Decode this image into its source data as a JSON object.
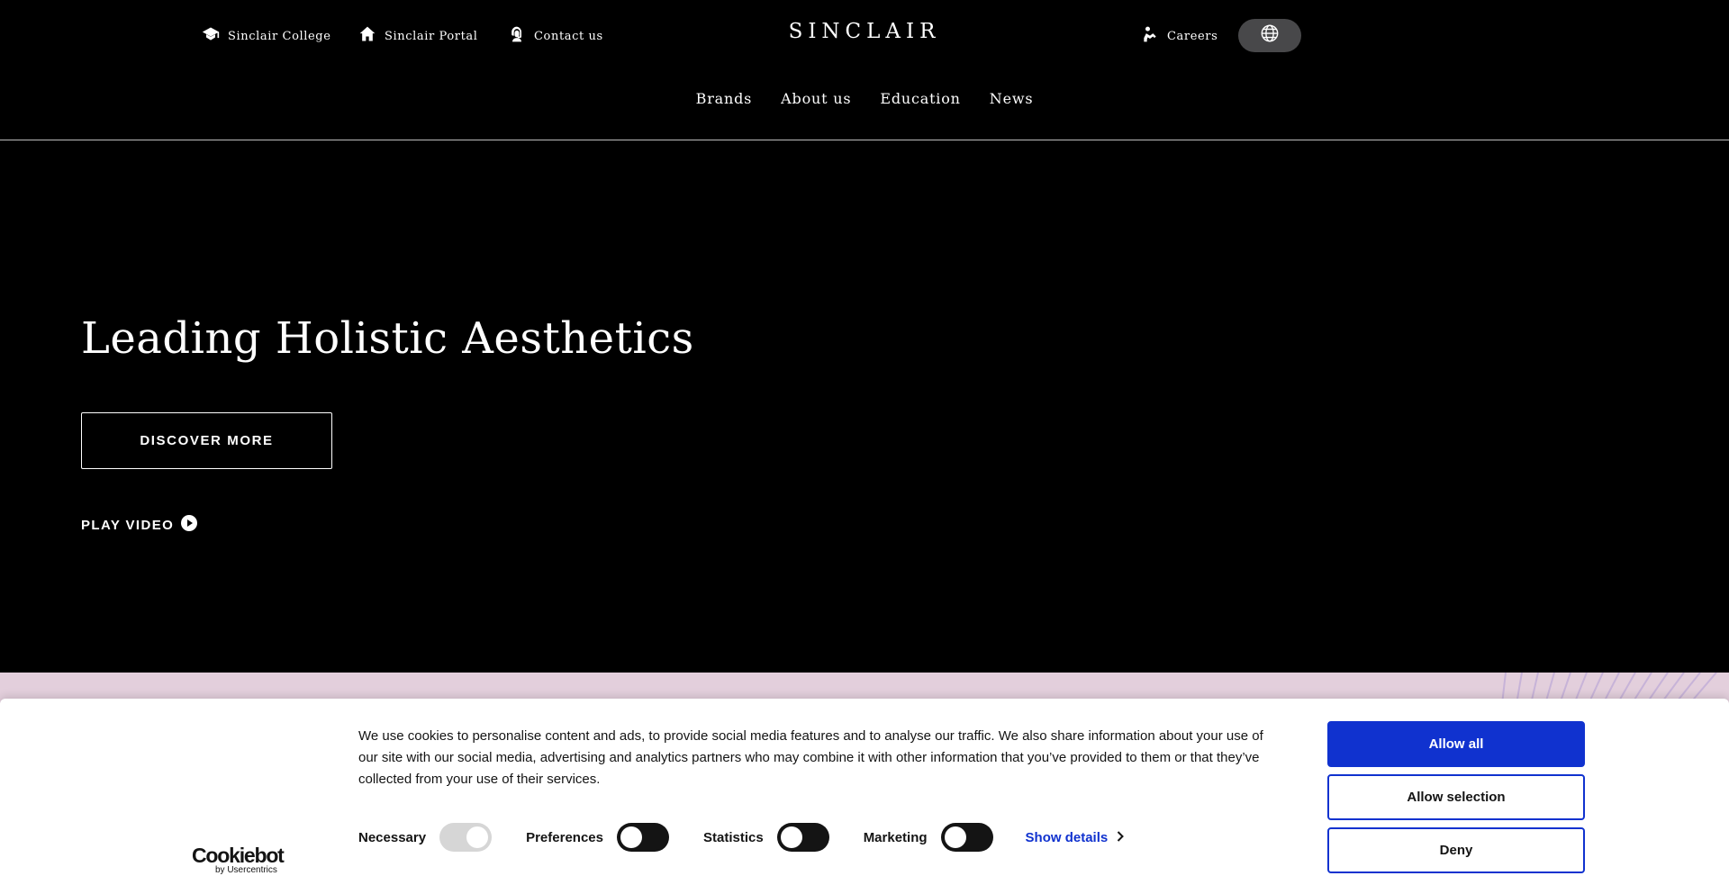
{
  "header": {
    "utility_left": [
      {
        "label": "Sinclair College",
        "icon": "graduation-cap-icon"
      },
      {
        "label": "Sinclair Portal",
        "icon": "home-icon"
      },
      {
        "label": "Contact us",
        "icon": "support-agent-icon"
      }
    ],
    "logo": "SINCLAIR",
    "careers": {
      "label": "Careers",
      "icon": "careers-icon"
    },
    "language_icon": "globe-icon",
    "nav": [
      "Brands",
      "About us",
      "Education",
      "News"
    ]
  },
  "hero": {
    "title": "Leading Holistic Aesthetics",
    "cta": "DISCOVER MORE",
    "play_video": "PLAY VIDEO"
  },
  "cookie_banner": {
    "logo_text": "Cookiebot",
    "logo_sub": "by Usercentrics",
    "text": "We use cookies to personalise content and ads, to provide social media features and to analyse our traffic. We also share information about your use of our site with our social media, advertising and analytics partners who may combine it with other information that you’ve provided to them or that they’ve collected from your use of their services.",
    "toggles": [
      {
        "label": "Necessary",
        "checked": true,
        "disabled": true
      },
      {
        "label": "Preferences",
        "checked": false
      },
      {
        "label": "Statistics",
        "checked": false
      },
      {
        "label": "Marketing",
        "checked": false
      }
    ],
    "show_details": "Show details",
    "buttons": {
      "allow_all": "Allow all",
      "allow_selection": "Allow selection",
      "deny": "Deny"
    }
  },
  "colors": {
    "background": "#000000",
    "accent_blue": "#1032cf",
    "pink_section": "#e3cfdc",
    "globe_button": "#48484a"
  }
}
